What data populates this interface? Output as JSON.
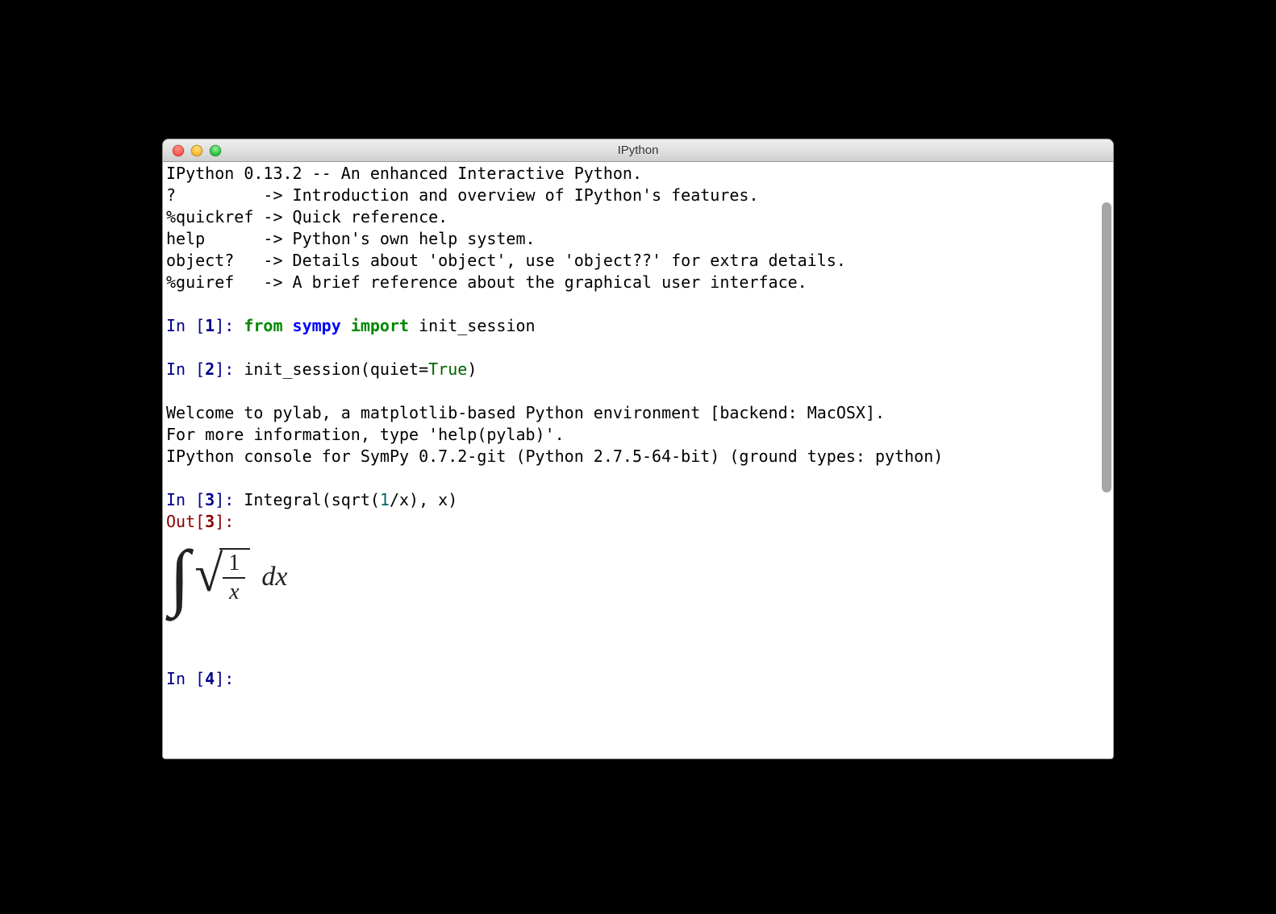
{
  "window": {
    "title": "IPython"
  },
  "banner": {
    "l1": "IPython 0.13.2 -- An enhanced Interactive Python.",
    "l2": "?         -> Introduction and overview of IPython's features.",
    "l3": "%quickref -> Quick reference.",
    "l4": "help      -> Python's own help system.",
    "l5": "object?   -> Details about 'object', use 'object??' for extra details.",
    "l6": "%guiref   -> A brief reference about the graphical user interface."
  },
  "prompts": {
    "in": "In [",
    "out": "Out[",
    "close": "]: ",
    "n1": "1",
    "n2": "2",
    "n3": "3",
    "n4": "4"
  },
  "code1": {
    "kw_from": "from",
    "mod": " sympy ",
    "kw_import": "import",
    "rest": " init_session"
  },
  "code2": {
    "pre": "init_session(quiet",
    "eq": "=",
    "val": "True",
    "post": ")"
  },
  "mid": {
    "l1": "Welcome to pylab, a matplotlib-based Python environment [backend: MacOSX].",
    "l2": "For more information, type 'help(pylab)'.",
    "l3": "IPython console for SymPy 0.7.2-git (Python 2.7.5-64-bit) (ground types: python)"
  },
  "code3": {
    "pre": "Integral(sqrt(",
    "one": "1",
    "slash": "/",
    "x1": "x), x)"
  },
  "formula": {
    "num": "1",
    "den": "x",
    "dx": "dx"
  }
}
